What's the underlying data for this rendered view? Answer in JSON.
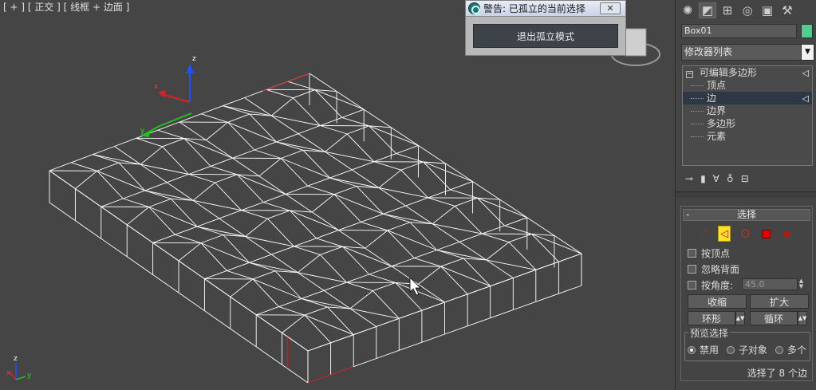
{
  "viewport": {
    "label": "[ + ] [ 正交 ] [ 线框 + 边面 ]",
    "axis_x": "x",
    "axis_y": "y",
    "axis_z": "z"
  },
  "isolate_dialog": {
    "title": "警告: 已孤立的当前选择",
    "close_glyph": "✕",
    "exit_button": "退出孤立模式"
  },
  "panel": {
    "tabs": [
      {
        "icon": "sun-icon",
        "glyph": "✺"
      },
      {
        "icon": "modify-icon",
        "glyph": "◩"
      },
      {
        "icon": "hierarchy-icon",
        "glyph": "⊞"
      },
      {
        "icon": "motion-icon",
        "glyph": "◎"
      },
      {
        "icon": "display-icon",
        "glyph": "▣"
      },
      {
        "icon": "utilities-icon",
        "glyph": "⚒"
      }
    ],
    "object_name": "Box01",
    "object_color": "#4fce8f",
    "modifier_list": "修改器列表",
    "stack": {
      "root": "可编辑多边形",
      "items": [
        "顶点",
        "边",
        "边界",
        "多边形",
        "元素"
      ],
      "selected": "边"
    },
    "selection": {
      "title": "选择",
      "by_vertex": "按顶点",
      "ignore_backfacing": "忽略背面",
      "by_angle": "按角度:",
      "angle_value": "45.0",
      "shrink": "收缩",
      "grow": "扩大",
      "ring": "环形",
      "loop": "循环",
      "preview_title": "预览选择",
      "preview_off": "禁用",
      "preview_subobj": "子对象",
      "preview_multi": "多个",
      "status": "选择了 8 个边"
    }
  }
}
